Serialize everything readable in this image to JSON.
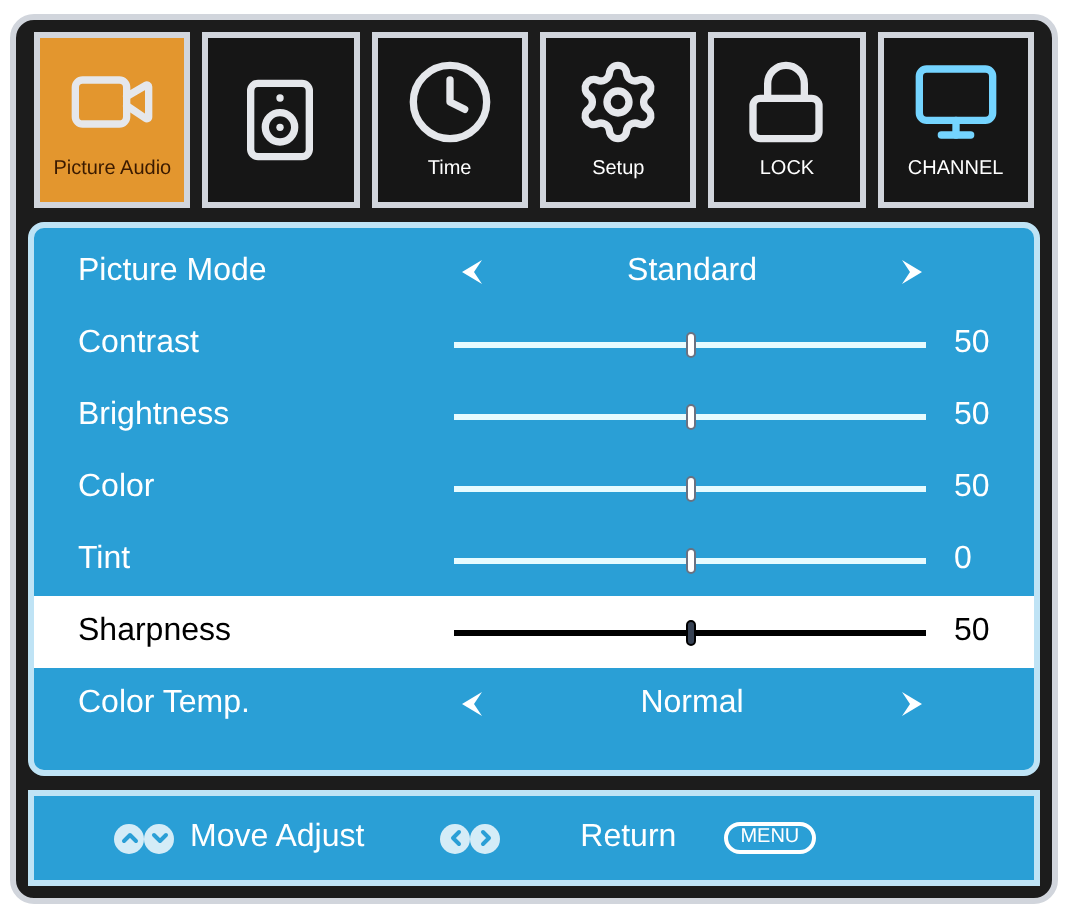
{
  "tabs": [
    {
      "label": "Picture Audio",
      "selected": true,
      "kind": "camera"
    },
    {
      "selected": false,
      "kind": "speaker"
    },
    {
      "label": "Time",
      "selected": false,
      "kind": "clock"
    },
    {
      "label": "Setup",
      "selected": false,
      "kind": "gear"
    },
    {
      "label": "LOCK",
      "selected": false,
      "kind": "lock"
    },
    {
      "label": "CHANNEL",
      "selected": false,
      "kind": "monitor"
    }
  ],
  "rows": [
    {
      "kind": "option",
      "label": "Picture Mode",
      "value": "Standard",
      "selected": false
    },
    {
      "kind": "slider",
      "label": "Contrast",
      "level": 0.5,
      "reading": "50",
      "selected": false
    },
    {
      "kind": "slider",
      "label": "Brightness",
      "level": 0.5,
      "reading": "50",
      "selected": false
    },
    {
      "kind": "slider",
      "label": "Color",
      "level": 0.5,
      "reading": "50",
      "selected": false
    },
    {
      "kind": "slider",
      "label": "Tint",
      "level": 0.5,
      "reading": "0",
      "selected": false
    },
    {
      "kind": "slider",
      "label": "Sharpness",
      "level": 0.5,
      "reading": "50",
      "selected": true
    },
    {
      "kind": "option",
      "label": "Color Temp.",
      "value": "Normal",
      "selected": false
    }
  ],
  "footer": {
    "move_label": "Move Adjust",
    "return_label": "Return",
    "menu_key": "MENU"
  }
}
